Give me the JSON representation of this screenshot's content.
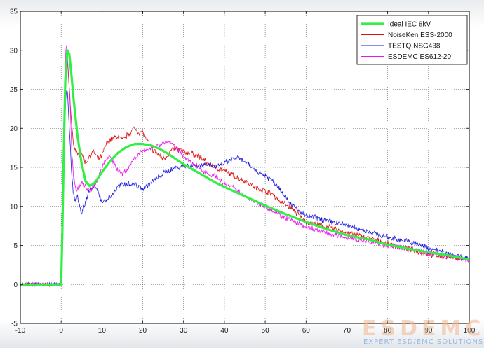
{
  "chart_data": {
    "type": "line",
    "title": "",
    "xlabel": "",
    "ylabel": "",
    "xlim": [
      -10,
      100
    ],
    "ylim": [
      -5,
      35
    ],
    "xticks": [
      -10,
      0,
      10,
      20,
      30,
      40,
      50,
      60,
      70,
      80,
      90,
      100
    ],
    "yticks": [
      -5,
      0,
      5,
      10,
      15,
      20,
      25,
      30,
      35
    ],
    "grid": true,
    "legend_position": "top-right",
    "series": [
      {
        "name": "Ideal IEC 8kV",
        "color": "#33ee44",
        "x": [
          -10,
          0,
          0.3,
          0.6,
          1,
          1.5,
          2,
          2.5,
          3,
          4,
          5,
          6,
          7,
          8,
          9,
          10,
          12,
          14,
          16,
          18,
          20,
          22,
          24,
          26,
          28,
          30,
          32,
          34,
          36,
          38,
          40,
          45,
          50,
          55,
          60,
          65,
          70,
          75,
          80,
          85,
          90,
          95,
          100
        ],
        "y": [
          0,
          0,
          7,
          16,
          26,
          30,
          29.5,
          27,
          24,
          19,
          15.5,
          13.2,
          12.6,
          12.9,
          13.6,
          14.4,
          15.8,
          16.9,
          17.6,
          18.0,
          18.0,
          17.8,
          17.4,
          16.8,
          16.1,
          15.4,
          14.8,
          14.2,
          13.6,
          13.0,
          12.5,
          11.3,
          10.1,
          9.0,
          8.0,
          7.1,
          6.3,
          5.8,
          5.1,
          4.6,
          4.1,
          3.7,
          3.2
        ]
      },
      {
        "name": "NoiseKen ESS-2000",
        "color": "#dd1111",
        "x": [
          -10,
          0,
          0.4,
          0.8,
          1,
          1.3,
          1.6,
          2,
          2.5,
          3,
          4,
          5,
          6,
          7,
          8,
          9,
          10,
          11,
          12,
          14,
          15,
          16,
          17,
          18,
          19,
          20,
          21,
          22,
          23,
          24,
          25,
          26,
          27,
          28,
          30,
          32,
          34,
          36,
          38,
          40,
          42,
          44,
          46,
          48,
          50,
          52,
          54,
          56,
          58,
          60,
          65,
          70,
          75,
          80,
          85,
          90,
          95,
          100
        ],
        "y": [
          0,
          0,
          8,
          20,
          26,
          29,
          28,
          25,
          21,
          18,
          16.5,
          17,
          15.5,
          16.5,
          17,
          16,
          16.5,
          18,
          18.5,
          19,
          18.5,
          19,
          19.5,
          20,
          19.5,
          19.5,
          18.5,
          17.5,
          17,
          16.5,
          16.2,
          16.5,
          17.2,
          17.5,
          17,
          16.8,
          16.3,
          15.5,
          15,
          14.5,
          14,
          13.5,
          13,
          12.3,
          12,
          11.5,
          10.5,
          10,
          9,
          8,
          7.4,
          6.6,
          6,
          5.2,
          4.5,
          3.9,
          3.5,
          3.2
        ]
      },
      {
        "name": "TESTQ NSG438",
        "color": "#1a1adf",
        "x": [
          -10,
          0,
          0.4,
          0.8,
          1.1,
          1.5,
          2,
          2.5,
          3,
          3.5,
          4,
          5,
          6,
          7,
          8,
          9,
          10,
          11,
          12,
          14,
          16,
          18,
          20,
          22,
          24,
          26,
          28,
          30,
          32,
          34,
          36,
          38,
          40,
          42,
          43,
          44,
          46,
          48,
          50,
          52,
          54,
          56,
          58,
          60,
          65,
          70,
          75,
          80,
          85,
          90,
          95,
          100
        ],
        "y": [
          0,
          0,
          8,
          18,
          24,
          25,
          20,
          15,
          11.5,
          10.5,
          11.5,
          9,
          10.5,
          12,
          12.5,
          12,
          10.5,
          10.8,
          11.2,
          12.5,
          13,
          12.8,
          12.3,
          13,
          13.8,
          14.5,
          15,
          15.2,
          15.2,
          15.3,
          15.5,
          15,
          15.5,
          16,
          16.3,
          16,
          15.3,
          14.5,
          14,
          13.2,
          12,
          10.5,
          9.5,
          8.8,
          8.2,
          7.6,
          6.8,
          6,
          5.5,
          4.7,
          3.9,
          3.3
        ]
      },
      {
        "name": "ESDEMC ES612-20",
        "color": "#ee11ee",
        "x": [
          -10,
          0,
          0.4,
          0.8,
          1.1,
          1.4,
          1.8,
          2.2,
          2.6,
          3,
          3.5,
          4,
          5,
          6,
          7,
          8,
          9,
          10,
          11,
          12,
          13,
          14,
          15,
          16,
          17,
          18,
          19,
          20,
          21,
          22,
          24,
          26,
          27,
          28,
          30,
          32,
          34,
          36,
          38,
          40,
          42,
          44,
          46,
          48,
          50,
          52,
          54,
          56,
          58,
          60,
          65,
          70,
          75,
          80,
          85,
          90,
          95,
          100
        ],
        "y": [
          0,
          0,
          10,
          24,
          30,
          30.5,
          27,
          23,
          17,
          14,
          12.5,
          12,
          13,
          12.5,
          12,
          12.5,
          13.5,
          15,
          16,
          16.5,
          15.5,
          14.5,
          14.2,
          14.5,
          15.5,
          16.2,
          16.8,
          17,
          17.2,
          17.6,
          17.9,
          18.3,
          18.2,
          17.5,
          16.5,
          15.5,
          14.9,
          14.2,
          13.8,
          12.8,
          12.4,
          11.8,
          11,
          10.5,
          10,
          9.4,
          8.8,
          8.3,
          7.8,
          7.3,
          6.6,
          6.0,
          5.5,
          5.0,
          4.6,
          4.1,
          3.6,
          3.1
        ]
      }
    ]
  },
  "watermark": {
    "logo_text": "ESDEMC",
    "tagline": "EXPERT ESD/EMC SOLUTIONS"
  }
}
